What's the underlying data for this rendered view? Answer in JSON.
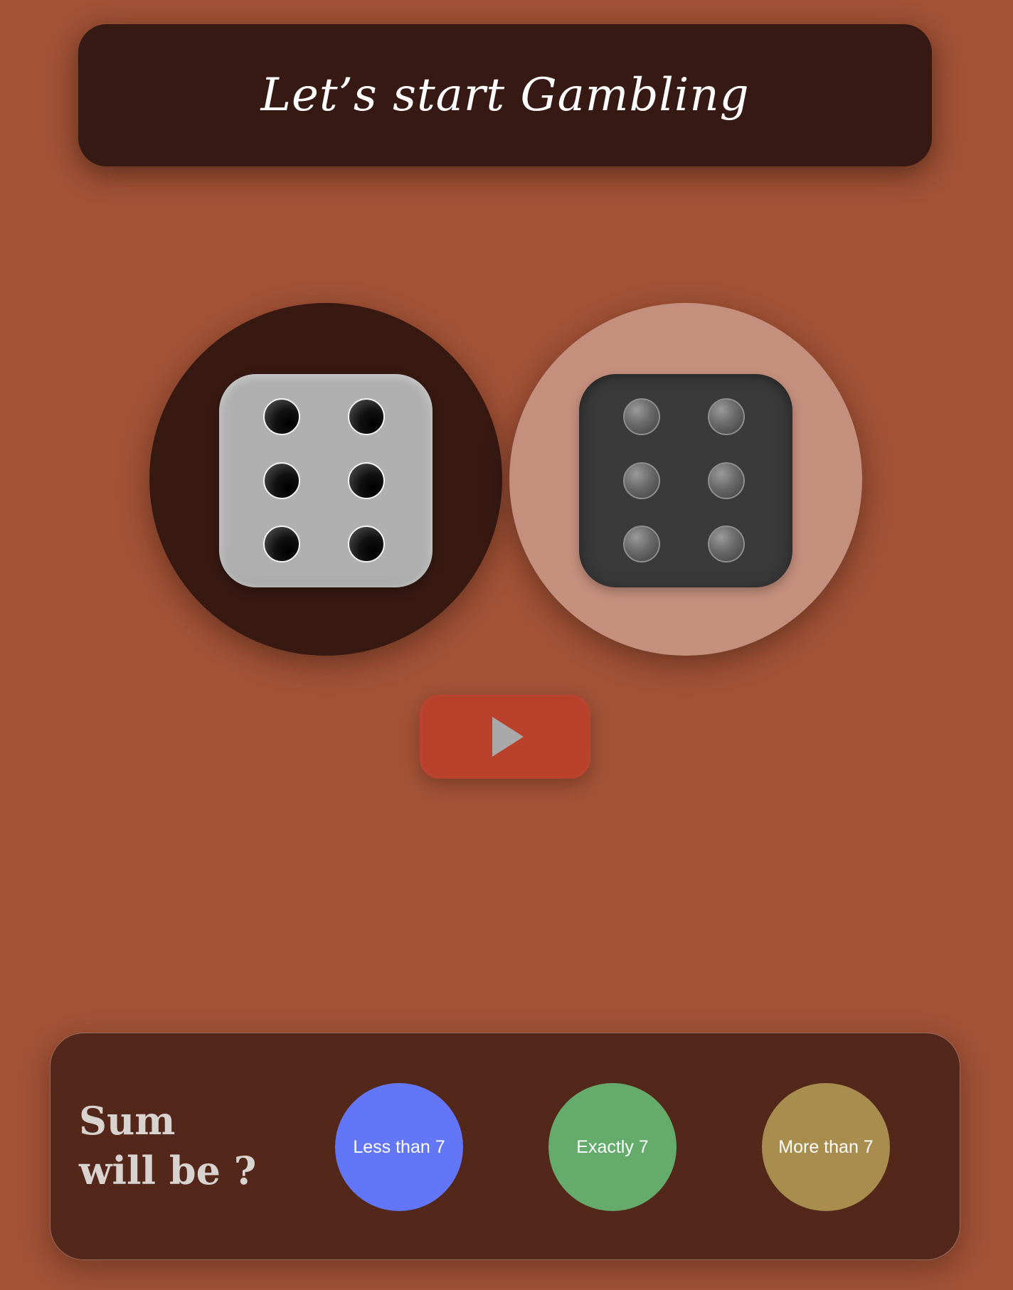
{
  "header": {
    "title": "Let’s start Gambling"
  },
  "dice": [
    {
      "value": 6,
      "style": "light",
      "disc_color": "#371912"
    },
    {
      "value": 6,
      "style": "dark",
      "disc_color": "#c58f7d"
    }
  ],
  "roll_button": {
    "icon": "play-icon",
    "color": "#b9402a"
  },
  "bet_panel": {
    "question": "Sum will be ?",
    "options": [
      {
        "label": "Less than 7",
        "color": "#6376f6"
      },
      {
        "label": "Exactly 7",
        "color": "#65ab6b"
      },
      {
        "label": "More than 7",
        "color": "#a98d4e"
      }
    ]
  },
  "colors": {
    "background": "#a35236",
    "header_bg": "#361912",
    "panel_bg": "#54271b"
  }
}
